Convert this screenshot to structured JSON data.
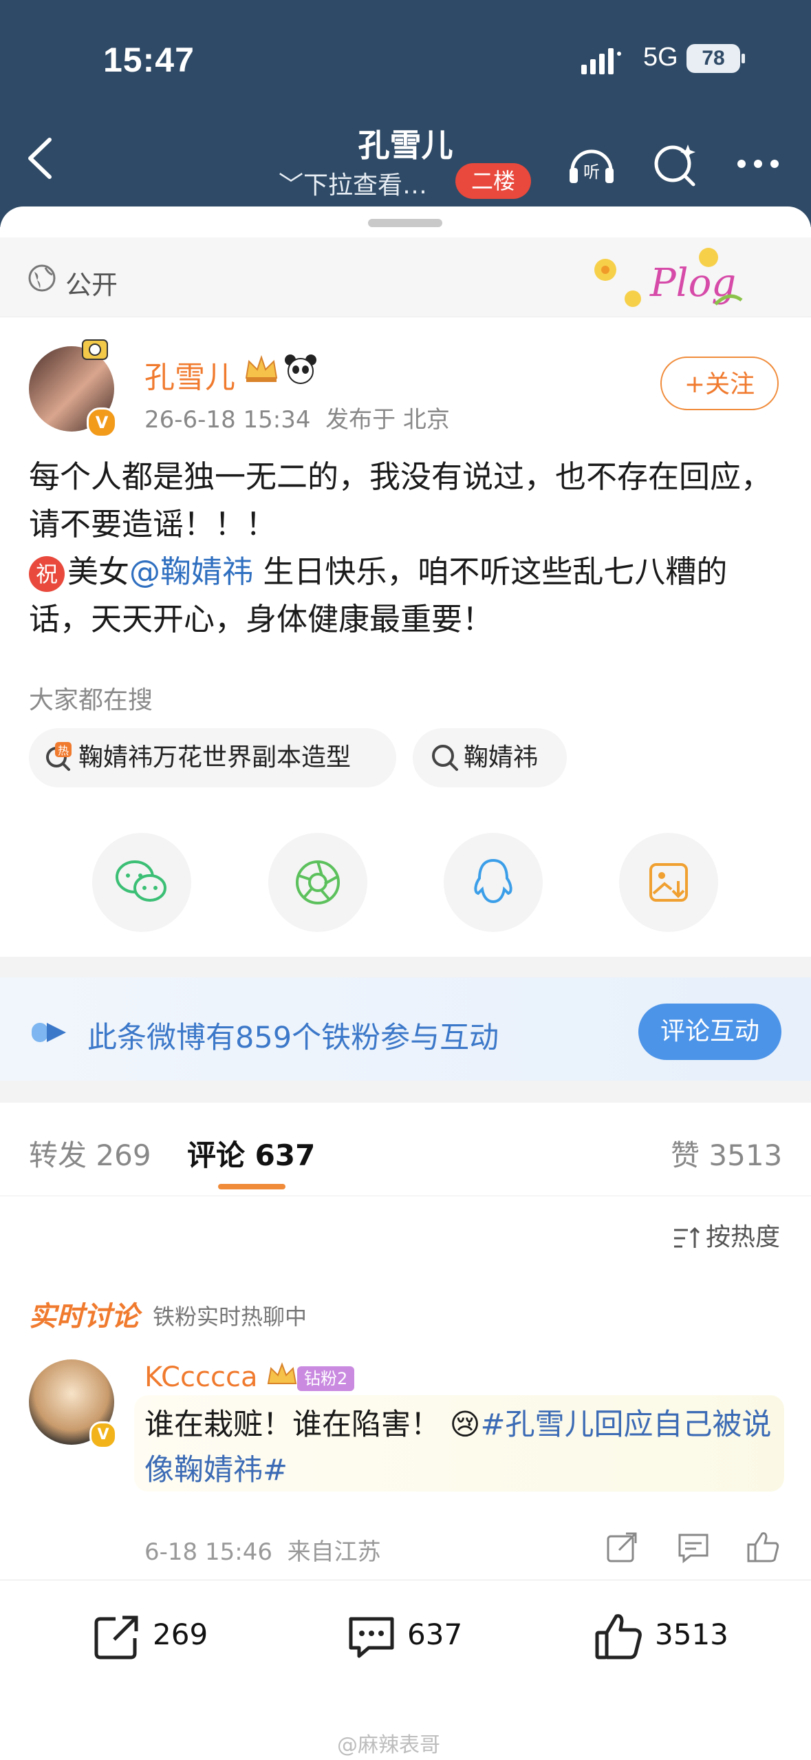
{
  "status_bar": {
    "time": "15:47",
    "network": "5G",
    "battery": "78"
  },
  "header": {
    "title": "孔雪儿",
    "subtitle": "下拉查看…",
    "floor_badge": "二楼"
  },
  "visibility": {
    "label": "公开",
    "sticker": "Plog"
  },
  "post": {
    "author": "孔雪儿",
    "avatar_badge": "V",
    "date": "26-6-18 15:34",
    "location": "发布于 北京",
    "follow_label": "+关注",
    "line1": "每个人都是独一无二的，我没有说过，也不存在回应，请不要造谣！！！",
    "zhu_icon": "祝",
    "line2_prefix": "美女",
    "mention": "@鞠婧祎",
    "line2_suffix": " 生日快乐，咱不听这些乱七八糟的话，天天开心，身体健康最重要！"
  },
  "search": {
    "label": "大家都在搜",
    "chips": [
      {
        "text": "鞠婧祎万花世界副本造型",
        "hot_tag": "热"
      },
      {
        "text": "鞠婧祎"
      }
    ]
  },
  "share_icons": [
    "wechat-icon",
    "moments-icon",
    "qq-icon",
    "save-image-icon"
  ],
  "fans_banner": {
    "text": "此条微博有859个铁粉参与互动",
    "button": "评论互动"
  },
  "tabs": {
    "repost_label": "转发",
    "repost_count": "269",
    "comment_label": "评论",
    "comment_count": "637",
    "like_label": "赞",
    "like_count": "3513"
  },
  "sort_label": "按热度",
  "live": {
    "title": "实时讨论",
    "subtitle": "铁粉实时热聊中"
  },
  "comment": {
    "user": "KCcccca",
    "level": "钻粉2",
    "avatar_badge": "V",
    "text_plain": "谁在栽赃！谁在陷害！",
    "emoji": "😢",
    "topic": "#孔雪儿回应自己被说像鞠婧祎#",
    "time": "6-18 15:46",
    "from": "来自江苏"
  },
  "bottom_bar": {
    "repost": "269",
    "comment": "637",
    "like": "3513"
  },
  "watermark": "@麻辣表哥",
  "colors": {
    "header_bg": "#2f4a66",
    "accent": "#f07a2e",
    "link": "#2f6fc0",
    "badge_red": "#e8493c"
  }
}
